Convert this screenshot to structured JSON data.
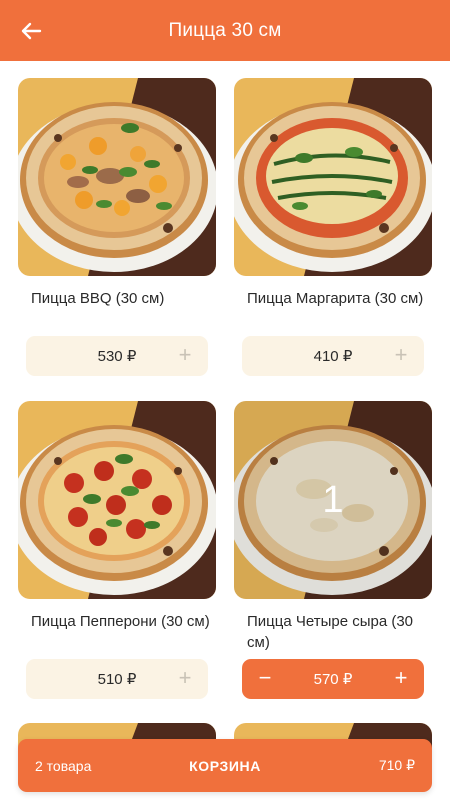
{
  "header": {
    "title": "Пицца 30 см",
    "back_icon": "arrow-left-icon"
  },
  "products": [
    {
      "name": "Пицца BBQ (30 см)",
      "price": "530 ₽",
      "quantity": null,
      "topping": "bbq"
    },
    {
      "name": "Пицца Маргарита (30 см)",
      "price": "410 ₽",
      "quantity": null,
      "topping": "margarita"
    },
    {
      "name": "Пицца Пепперони (30 см)",
      "price": "510 ₽",
      "quantity": null,
      "topping": "pepperoni"
    },
    {
      "name": "Пицца Четыре сыра (30 см)",
      "price": "570 ₽",
      "quantity": "1",
      "topping": "cheese"
    }
  ],
  "controls": {
    "plus": "+",
    "minus": "−"
  },
  "cart": {
    "count": "2 товара",
    "label": "КОРЗИНА",
    "total": "710 ₽"
  },
  "colors": {
    "accent": "#f0703c",
    "price_bg": "#fbf3e4"
  }
}
